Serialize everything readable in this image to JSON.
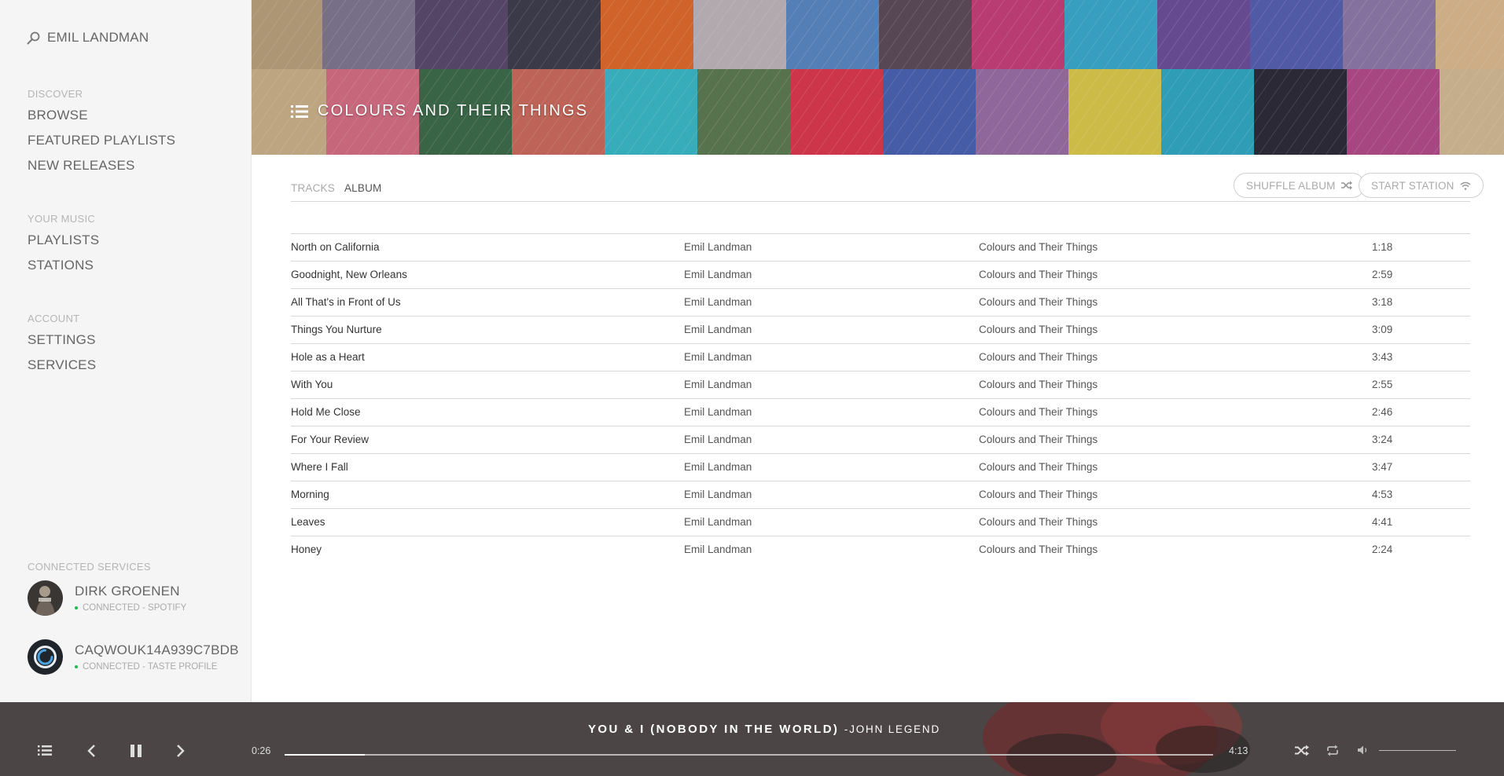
{
  "search": {
    "value": "EMIL LANDMAN",
    "icon": "search-icon"
  },
  "sidebar": {
    "sections": [
      {
        "heading": "DISCOVER",
        "items": [
          "BROWSE",
          "FEATURED PLAYLISTS",
          "NEW RELEASES"
        ]
      },
      {
        "heading": "YOUR MUSIC",
        "items": [
          "PLAYLISTS",
          "STATIONS"
        ]
      },
      {
        "heading": "ACCOUNT",
        "items": [
          "SETTINGS",
          "SERVICES"
        ]
      }
    ],
    "services_heading": "CONNECTED SERVICES",
    "services": [
      {
        "name": "DIRK GROENEN",
        "status": "CONNECTED - SPOTIFY",
        "status_color": "#1db954"
      },
      {
        "name": "CAQWOUK14A939C7BDB",
        "status": "CONNECTED - TASTE PROFILE",
        "status_color": "#1db954"
      }
    ]
  },
  "banner": {
    "title": "COLOURS AND THEIR THINGS",
    "icon": "list-icon"
  },
  "tabs": [
    {
      "label": "TRACKS",
      "active": false
    },
    {
      "label": "ALBUM",
      "active": true
    }
  ],
  "actions": {
    "shuffle_label": "SHUFFLE ALBUM",
    "shuffle_icon": "shuffle-icon",
    "station_label": "START STATION",
    "station_icon": "wifi-icon"
  },
  "tracks": [
    {
      "title": "North on California",
      "artist": "Emil Landman",
      "album": "Colours and Their Things",
      "duration": "1:18"
    },
    {
      "title": "Goodnight, New Orleans",
      "artist": "Emil Landman",
      "album": "Colours and Their Things",
      "duration": "2:59"
    },
    {
      "title": "All That's in Front of Us",
      "artist": "Emil Landman",
      "album": "Colours and Their Things",
      "duration": "3:18"
    },
    {
      "title": "Things You Nurture",
      "artist": "Emil Landman",
      "album": "Colours and Their Things",
      "duration": "3:09"
    },
    {
      "title": "Hole as a Heart",
      "artist": "Emil Landman",
      "album": "Colours and Their Things",
      "duration": "3:43"
    },
    {
      "title": "With You",
      "artist": "Emil Landman",
      "album": "Colours and Their Things",
      "duration": "2:55"
    },
    {
      "title": "Hold Me Close",
      "artist": "Emil Landman",
      "album": "Colours and Their Things",
      "duration": "2:46"
    },
    {
      "title": "For Your Review",
      "artist": "Emil Landman",
      "album": "Colours and Their Things",
      "duration": "3:24"
    },
    {
      "title": "Where I Fall",
      "artist": "Emil Landman",
      "album": "Colours and Their Things",
      "duration": "3:47"
    },
    {
      "title": "Morning",
      "artist": "Emil Landman",
      "album": "Colours and Their Things",
      "duration": "4:53"
    },
    {
      "title": "Leaves",
      "artist": "Emil Landman",
      "album": "Colours and Their Things",
      "duration": "4:41"
    },
    {
      "title": "Honey",
      "artist": "Emil Landman",
      "album": "Colours and Their Things",
      "duration": "2:24"
    }
  ],
  "player": {
    "song": "YOU & I (NOBODY IN THE WORLD)",
    "separator": "-",
    "artist": "JOHN LEGEND",
    "elapsed": "0:26",
    "total": "4:13",
    "progress_fraction": 0.086,
    "volume_fraction": 0.0,
    "icons": [
      "queue-icon",
      "previous-icon",
      "pause-icon",
      "next-icon",
      "shuffle-icon",
      "repeat-icon",
      "volume-icon"
    ]
  },
  "colors": {
    "sidebar_bg": "#f5f5f5",
    "player_bg": "#4b4645",
    "status_dot": "#1db954"
  }
}
